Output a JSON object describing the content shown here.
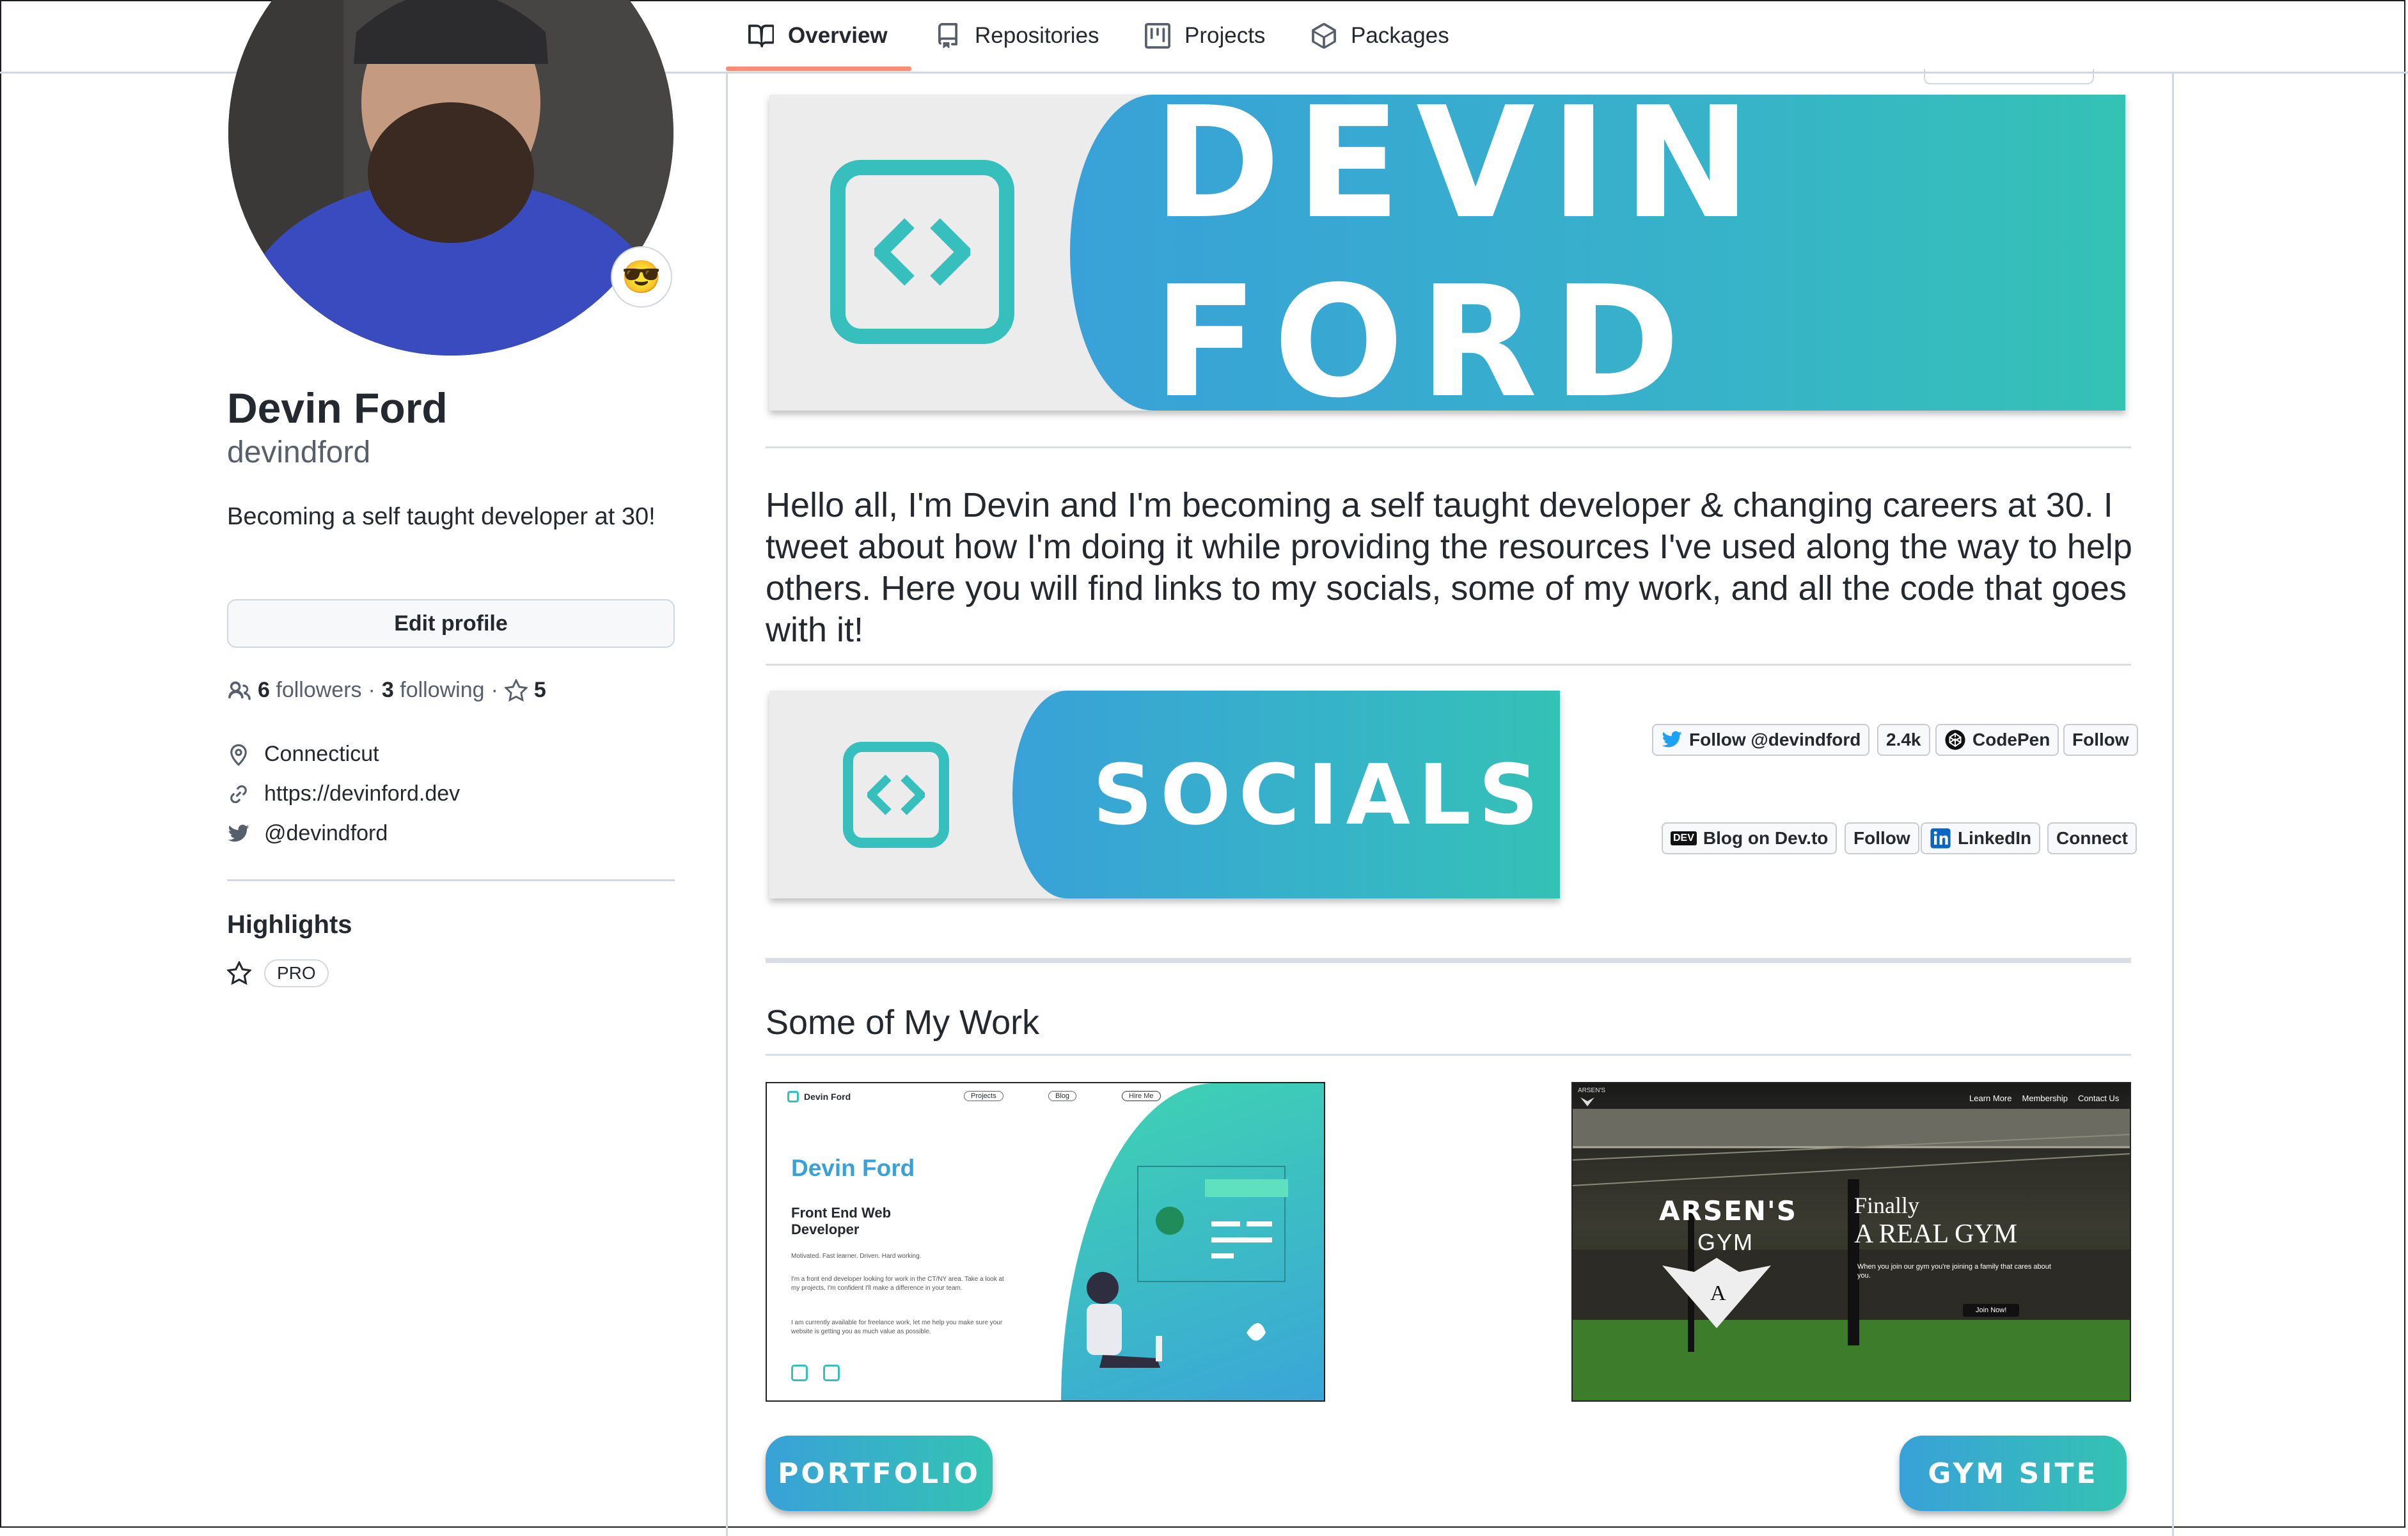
{
  "tabs": [
    {
      "label": "Overview"
    },
    {
      "label": "Repositories"
    },
    {
      "label": "Projects"
    },
    {
      "label": "Packages"
    }
  ],
  "profile": {
    "status_emoji": "😎",
    "full_name": "Devin Ford",
    "username": "devindford",
    "bio": "Becoming a self taught developer at 30!",
    "edit_profile_label": "Edit profile",
    "followers_count": "6",
    "followers_label": "followers",
    "following_count": "3",
    "following_label": "following",
    "stars_count": "5",
    "location": "Connecticut",
    "website": "https://devinford.dev",
    "twitter": "@devindford",
    "highlights_title": "Highlights",
    "pro_badge": "PRO"
  },
  "readme": {
    "banner_text": "DEVIN FORD",
    "intro": "Hello all, I'm Devin and I'm becoming a self taught developer & changing careers at 30. I tweet about how I'm doing it while providing the resources I've used along the way to help others. Here you will find links to my socials, some of my work, and all the code that goes with it!",
    "socials_text": "SOCIALS",
    "badges": {
      "twitter_follow": "Follow @devindford",
      "twitter_count": "2.4k",
      "codepen": "CodePen",
      "codepen_follow": "Follow",
      "devto": "Blog on Dev.to",
      "devto_follow": "Follow",
      "devto_logo": "DEV",
      "linkedin": "LinkedIn",
      "linkedin_connect": "Connect"
    },
    "work_title": "Some of My Work",
    "portfolio_shot": {
      "logo_name": "Devin Ford",
      "nav": [
        "Projects",
        "Blog",
        "Hire Me"
      ],
      "title": "Devin Ford",
      "subtitle": "Front End Web Developer",
      "tagline": "Motivated. Fast learner. Driven. Hard working.",
      "para1": "I'm a front end developer looking for work in the CT/NY area. Take a look at my projects, I'm confident I'll make a difference in your team.",
      "para2": "I am currently available for freelance work, let me help you make sure your website is getting you as much value as possible."
    },
    "gym_shot": {
      "brand_small": "ARSEN'S",
      "nav": [
        "Learn More",
        "Membership",
        "Contact Us"
      ],
      "brand_line1": "ARSEN'S",
      "brand_line2": "GYM",
      "brand_initial": "A",
      "headline1": "Finally",
      "headline2": "A REAL GYM",
      "blurb": "When you join our gym you're joining a family that cares about you.",
      "button": "Join Now!"
    },
    "portfolio_button": "PORTFOLIO",
    "gym_button": "GYM SITE"
  },
  "colors": {
    "accent_underline": "#fd8c73",
    "banner_blue": "#39a1d8",
    "banner_teal": "#34c3b3"
  }
}
